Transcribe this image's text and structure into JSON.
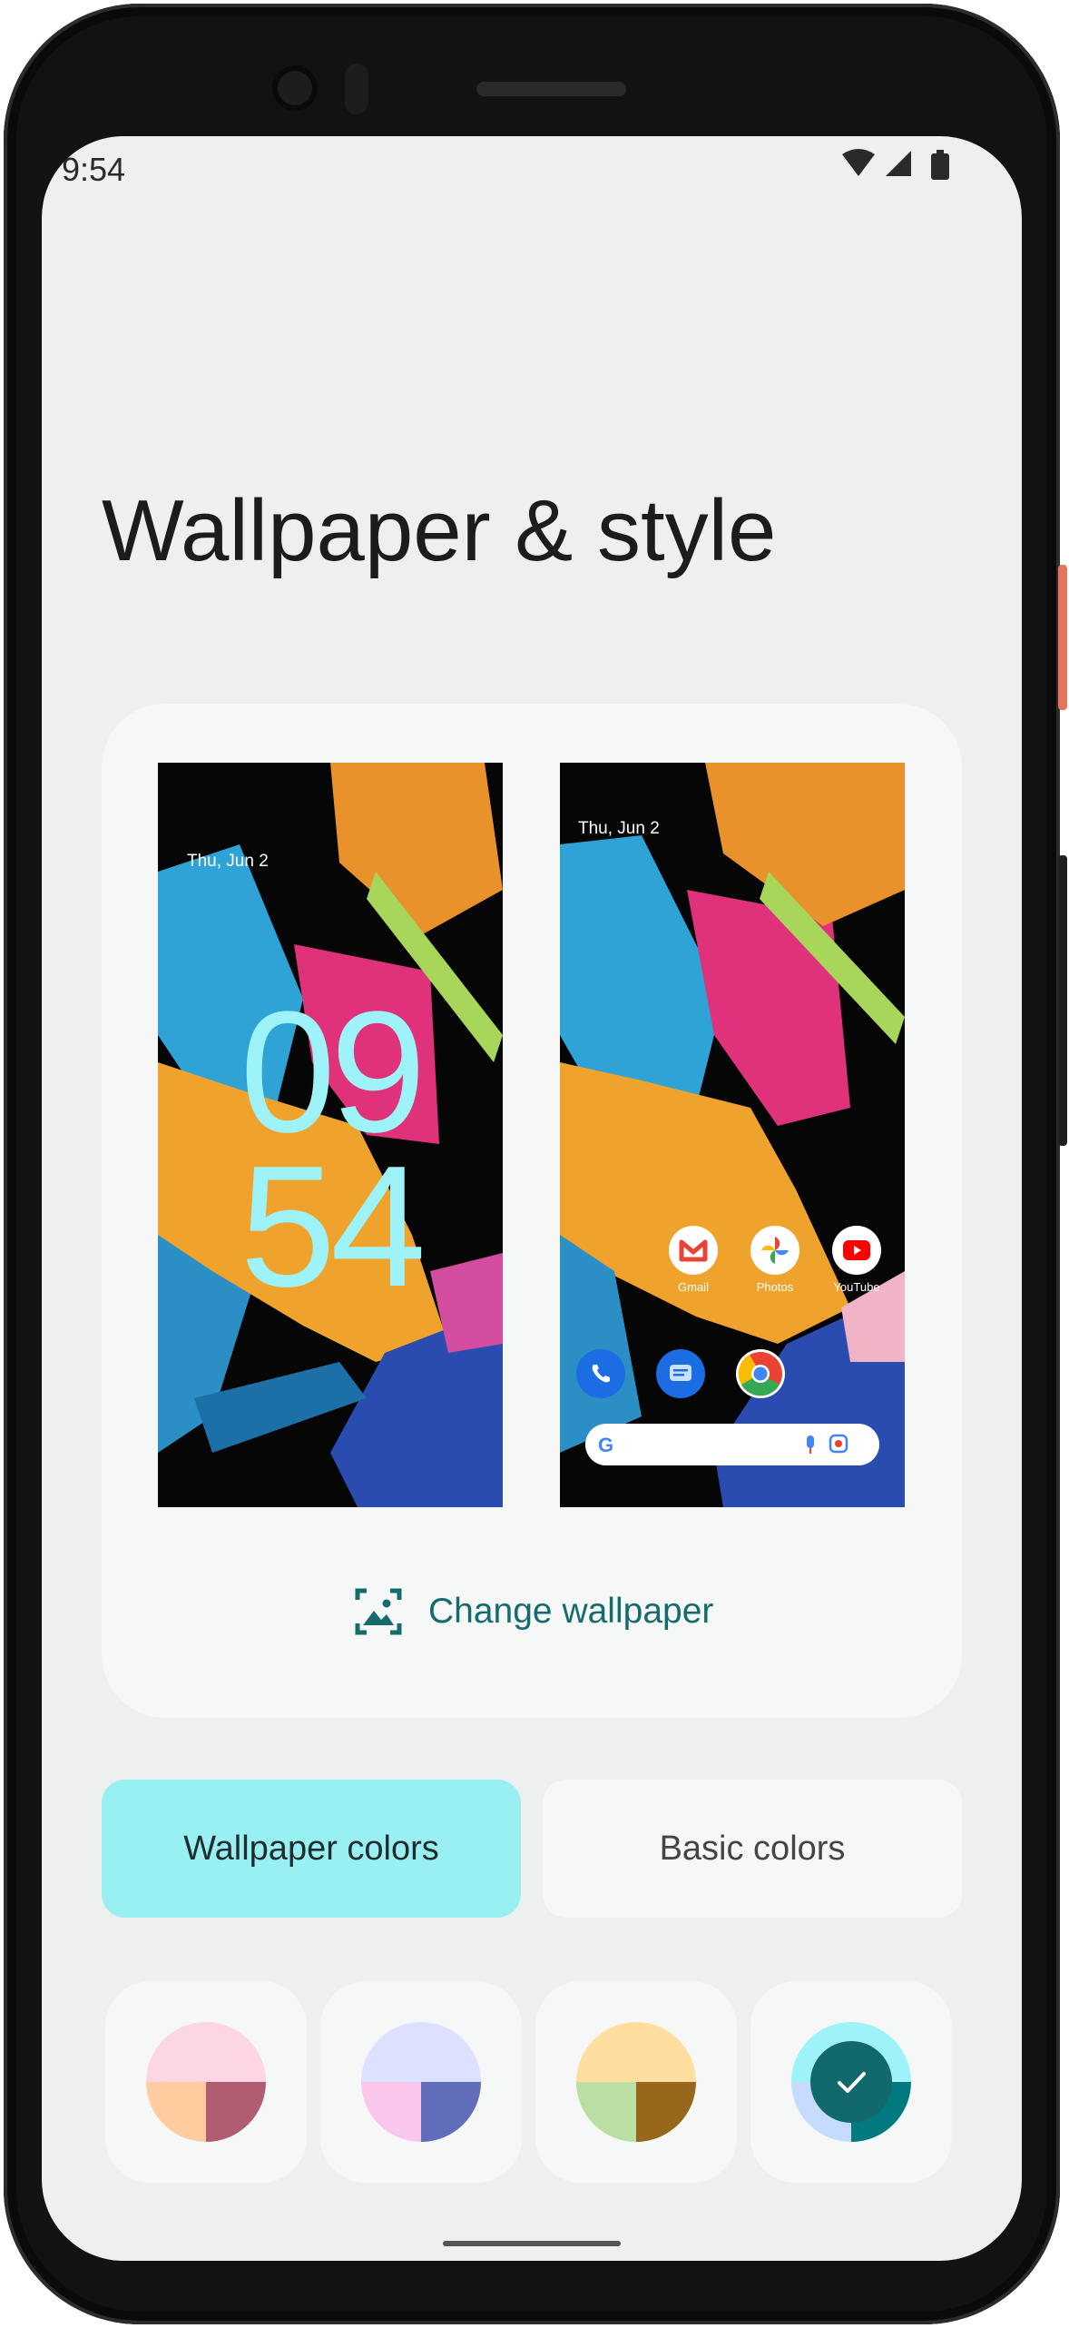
{
  "status_bar": {
    "time": "9:54",
    "icons": [
      "wifi-icon",
      "cell-signal-icon",
      "battery-icon"
    ]
  },
  "page": {
    "title": "Wallpaper & style"
  },
  "lock_preview": {
    "date": "Thu, Jun 2",
    "clock_hour": "09",
    "clock_minute": "54"
  },
  "home_preview": {
    "date": "Thu, Jun 2",
    "apps": [
      {
        "label": "Gmail"
      },
      {
        "label": "Photos"
      },
      {
        "label": "YouTube"
      }
    ],
    "dock": [
      "phone-icon",
      "messages-icon",
      "chrome-icon"
    ],
    "search_icons": [
      "google-icon",
      "mic-icon",
      "lens-icon"
    ]
  },
  "actions": {
    "change_wallpaper": "Change wallpaper"
  },
  "tabs": [
    {
      "label": "Wallpaper colors",
      "selected": true
    },
    {
      "label": "Basic colors",
      "selected": false
    }
  ],
  "swatches": [
    {
      "name": "pink",
      "top": "#fcd6e2",
      "bottom_left": "#ffcb9f",
      "bottom_right": "#b05c71",
      "selected": false
    },
    {
      "name": "lavender",
      "top": "#dde1ff",
      "bottom_left": "#f9c6ec",
      "bottom_right": "#5f6dbb",
      "selected": false
    },
    {
      "name": "amber",
      "top": "#ffdea0",
      "bottom_left": "#b9dfa3",
      "bottom_right": "#97681c",
      "selected": false
    },
    {
      "name": "teal",
      "top": "#9df3f8",
      "bottom_left": "#c5dcff",
      "bottom_right": "#007a7f",
      "selected": true
    }
  ],
  "colors": {
    "accent": "#166b6e",
    "tab_selected": "#98f0f3",
    "clock": "#9df3f8",
    "screen_bg": "#eef0ef"
  }
}
